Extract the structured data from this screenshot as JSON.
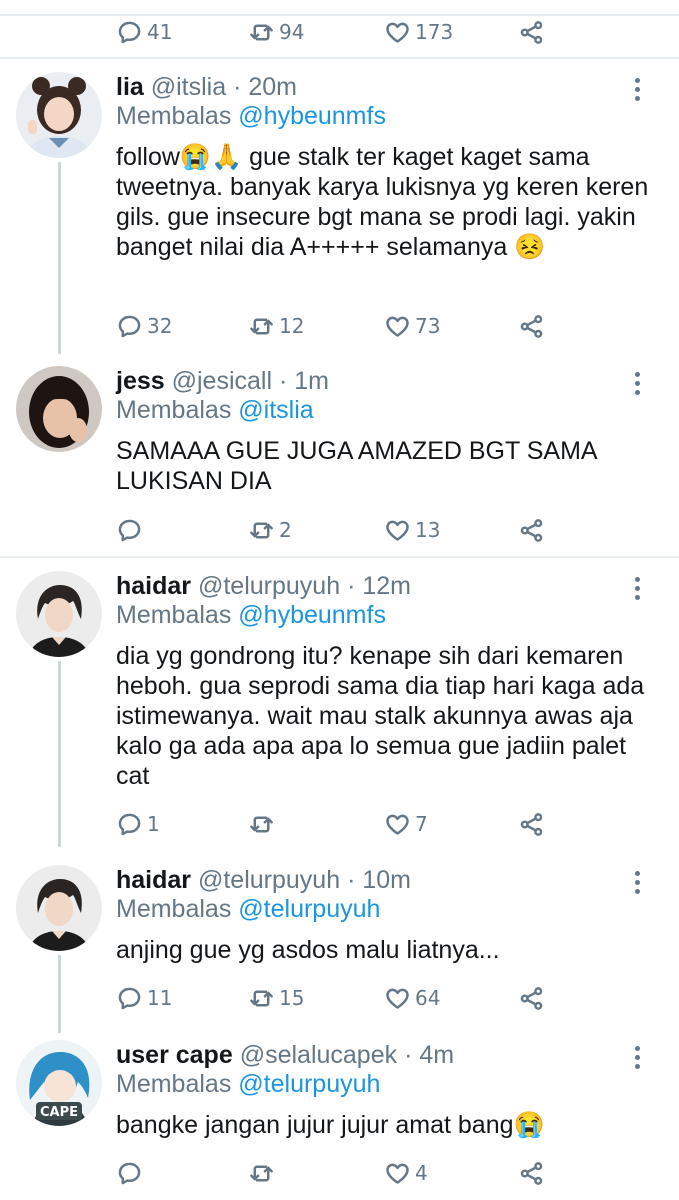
{
  "top_actions": {
    "reply": "41",
    "retweet": "94",
    "like": "173"
  },
  "replies": [
    {
      "name": "lia",
      "handle": "@itslia",
      "time": "20m",
      "replying_prefix": "Membalas",
      "replying_to": "@hybeunmfs",
      "text": "follow😭🙏 gue stalk ter kaget kaget sama tweetnya. banyak karya lukisnya yg keren keren gils. gue insecure bgt mana se prodi lagi. yakin banget nilai dia A+++++ selamanya 😣",
      "reply_count": "32",
      "retweet_count": "12",
      "like_count": "73"
    },
    {
      "name": "jess",
      "handle": "@jesicall",
      "time": "1m",
      "replying_prefix": "Membalas",
      "replying_to": "@itslia",
      "text": "SAMAAA GUE JUGA AMAZED BGT SAMA LUKISAN DIA",
      "reply_count": "",
      "retweet_count": "2",
      "like_count": "13"
    },
    {
      "name": "haidar",
      "handle": "@telurpuyuh",
      "time": "12m",
      "replying_prefix": "Membalas",
      "replying_to": "@hybeunmfs",
      "text": "dia yg gondrong itu? kenape sih dari kemaren heboh. gua seprodi sama dia tiap hari kaga ada istimewanya. wait mau stalk akunnya awas aja kalo ga ada apa apa lo semua gue jadiin palet cat",
      "reply_count": "1",
      "retweet_count": "",
      "like_count": "7"
    },
    {
      "name": "haidar",
      "handle": "@telurpuyuh",
      "time": "10m",
      "replying_prefix": "Membalas",
      "replying_to": "@telurpuyuh",
      "text": "anjing gue yg asdos malu liatnya...",
      "reply_count": "11",
      "retweet_count": "15",
      "like_count": "64"
    },
    {
      "name": "user cape",
      "handle": "@selalucapek",
      "time": "4m",
      "replying_prefix": "Membalas",
      "replying_to": "@telurpuyuh",
      "text": "bangke jangan jujur jujur amat bang😭",
      "reply_count": "",
      "retweet_count": "",
      "like_count": "4",
      "avatar_caption": "CAPE"
    }
  ],
  "colors": {
    "link": "#1b95e0",
    "muted": "#657786",
    "divider": "#e6ecf0",
    "thread_line": "#ccd6dd"
  }
}
